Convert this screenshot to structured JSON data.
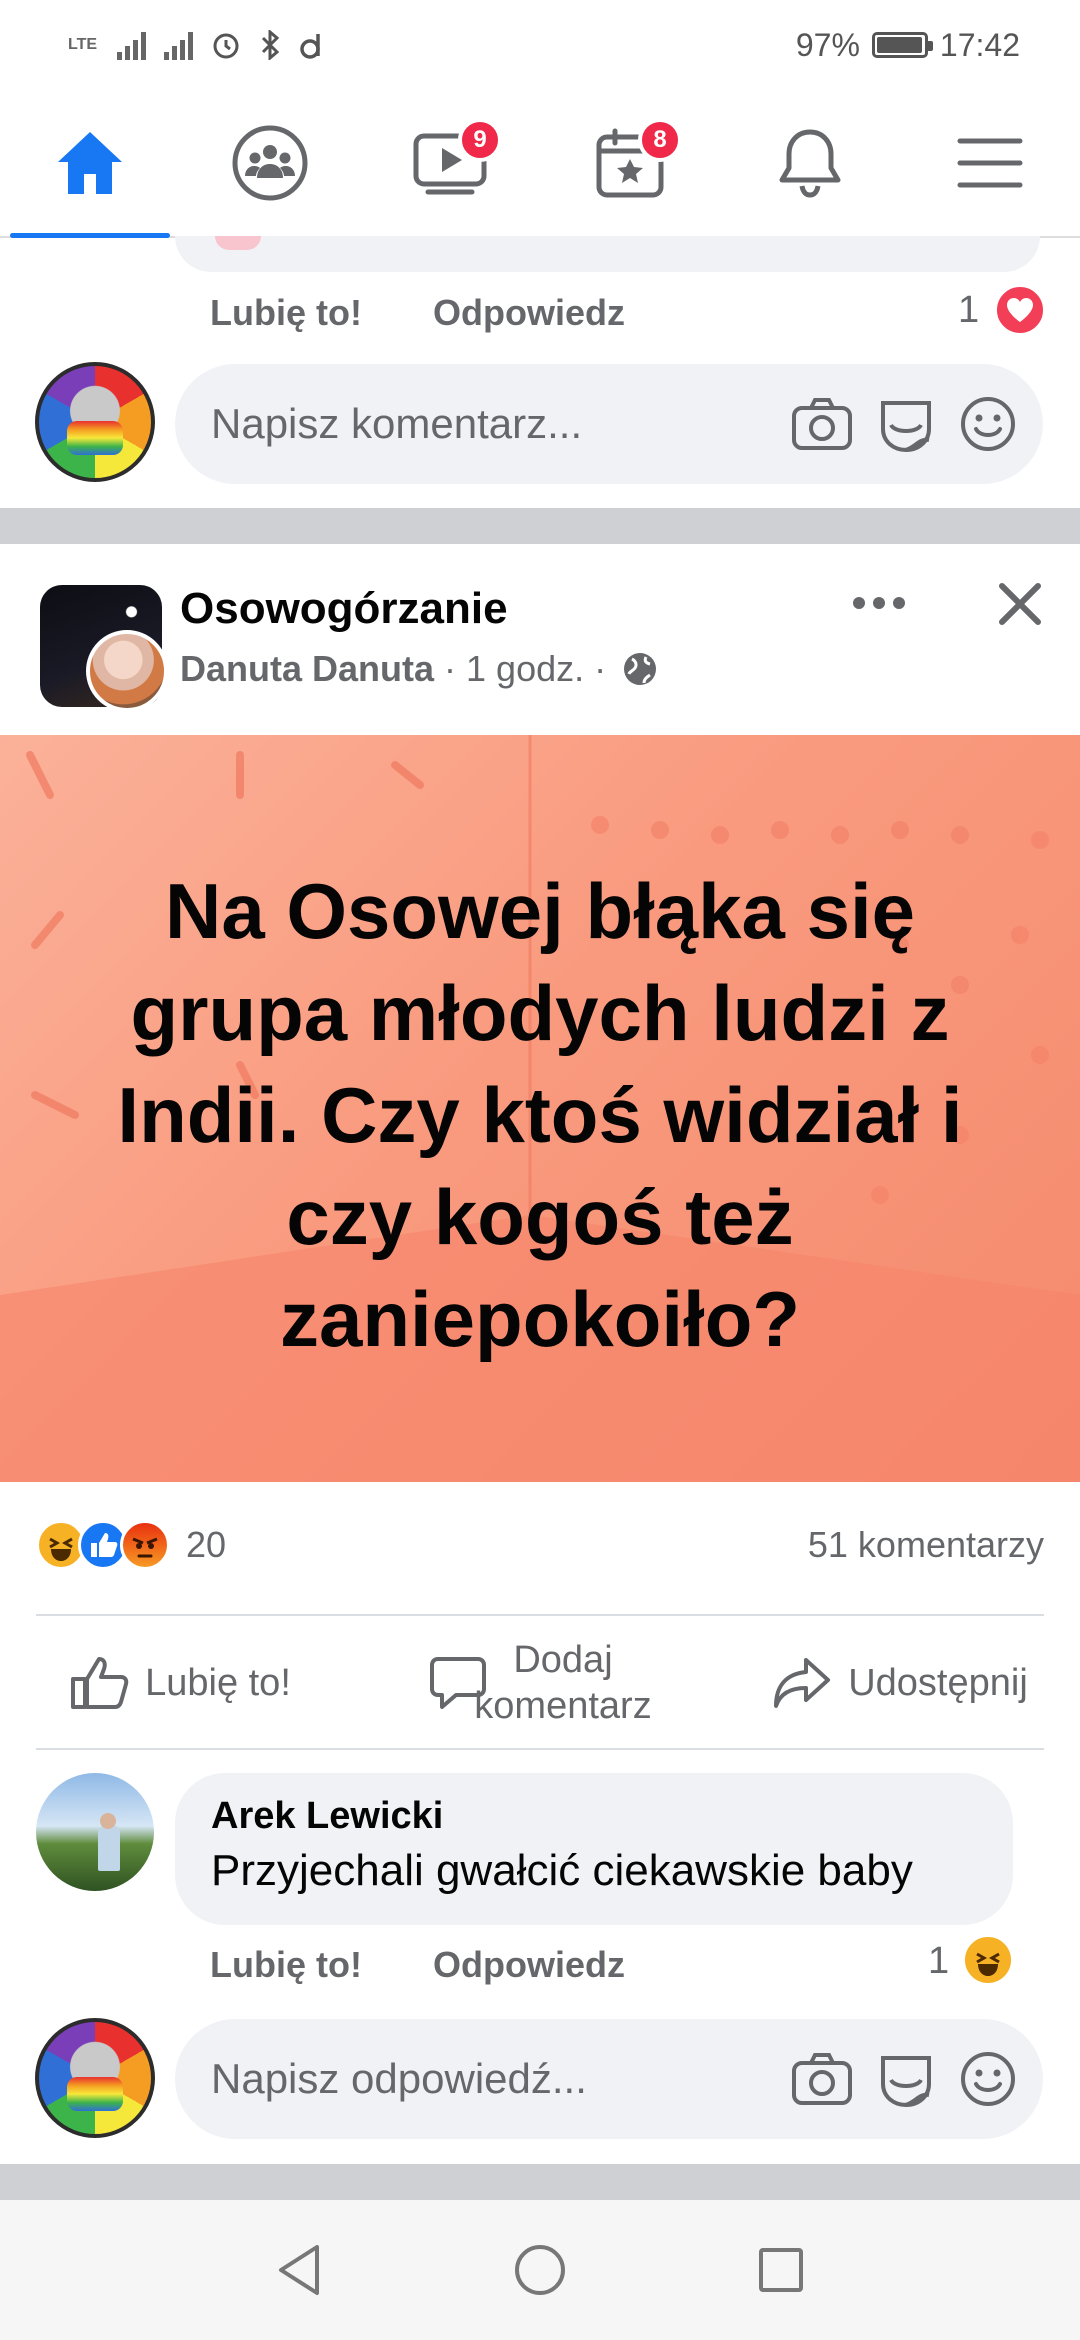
{
  "status": {
    "network": "LTE",
    "battery_percent": "97%",
    "battery_level": 0.97,
    "time": "17:42"
  },
  "nav": {
    "video_badge": "9",
    "events_badge": "8"
  },
  "prev_comment": {
    "like_label": "Lubię to!",
    "reply_label": "Odpowiedz",
    "reaction_count": "1",
    "input_placeholder": "Napisz komentarz..."
  },
  "post": {
    "group_name": "Osowogórzanie",
    "author": "Danuta Danuta",
    "time": " · 1 godz. · ",
    "image_text": "Na Osowej błąka się grupa młodych ludzi z Indii. Czy ktoś widział i czy  kogoś też zaniepokoiło?",
    "reactions_count": "20",
    "comments_count": "51 komentarzy",
    "like_action": "Lubię to!",
    "comment_action_line1": "Dodaj",
    "comment_action_line2": "komentarz",
    "share_action": "Udostępnij"
  },
  "comment": {
    "author": "Arek Lewicki",
    "text": "Przyjechali gwałcić ciekawskie baby",
    "like_label": "Lubię to!",
    "reply_label": "Odpowiedz",
    "reaction_count": "1",
    "reply_placeholder": "Napisz odpowiedź..."
  },
  "colors": {
    "brand": "#1877f2",
    "badge": "#f02849",
    "love": "#f33e58",
    "haha": "#f7b125",
    "angry": "#e9710f"
  }
}
